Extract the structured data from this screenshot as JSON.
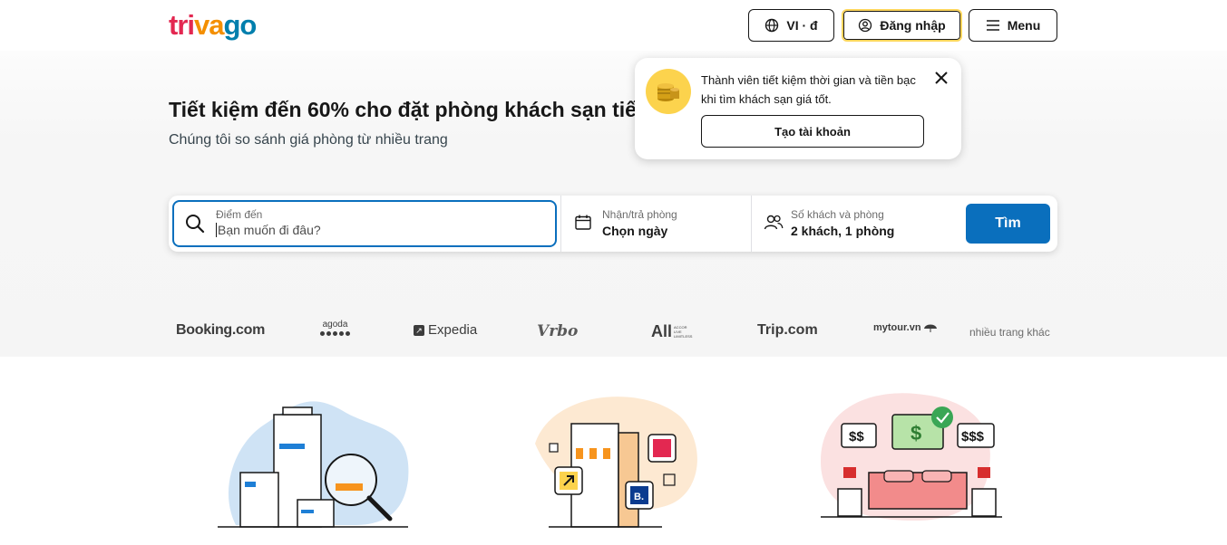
{
  "header": {
    "logo": {
      "t": "t",
      "ri": "ri",
      "va": "va",
      "go": "go"
    },
    "lang_label": "VI · đ",
    "login_label": "Đăng nhập",
    "menu_label": "Menu"
  },
  "popover": {
    "message": "Thành viên tiết kiệm thời gian và tiền bạc khi tìm khách sạn giá tốt.",
    "create_account": "Tạo tài khoản"
  },
  "hero": {
    "title": "Tiết kiệm đến 60% cho đặt phòng khách sạn tiếp theo",
    "subtitle": "Chúng tôi so sánh giá phòng từ nhiều trang"
  },
  "search": {
    "destination_label": "Điểm đến",
    "destination_placeholder": "Bạn muốn đi đâu?",
    "dates_label": "Nhận/trả phòng",
    "dates_value": "Chọn ngày",
    "guests_label": "Số khách và phòng",
    "guests_value": "2 khách, 1 phòng",
    "submit_label": "Tìm"
  },
  "partners": {
    "booking": "Booking.com",
    "agoda": "agoda",
    "expedia": "Expedia",
    "vrbo": "Vrbo",
    "all": "All",
    "all_small": [
      "ACCOR",
      "LIVE",
      "LIMITLESS"
    ],
    "trip": "Trip.com",
    "mytour": "mytour.vn",
    "more": "nhiều trang khác"
  },
  "illustrations": {
    "price_tags": [
      "$$",
      "$",
      "$$$"
    ],
    "booking_badge": "B."
  },
  "colors": {
    "primary_blue": "#0a6fbd",
    "logo_red": "#e32851",
    "logo_orange": "#f48f00",
    "logo_blue": "#007fad",
    "login_highlight": "#fed65c"
  }
}
